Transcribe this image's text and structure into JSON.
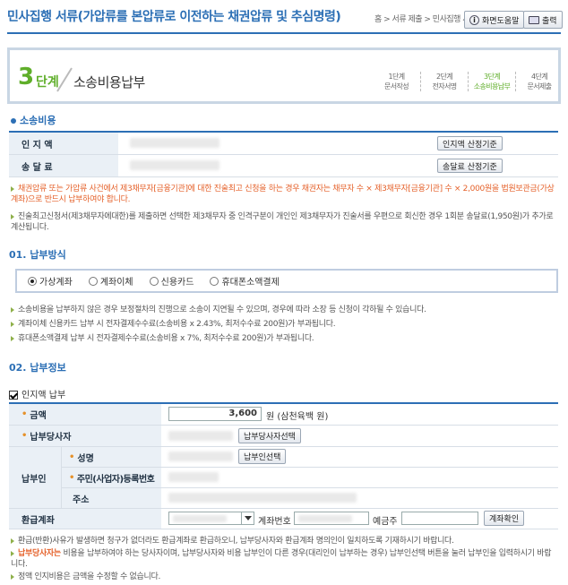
{
  "header": {
    "title": "민사집행 서류(가압류를 본압류로 이전하는 채권압류 및 추심명령)",
    "breadcrumb": "홈 > 서류 제출 > 민사집행 서",
    "help_label": "화면도움말",
    "print_label": "출력"
  },
  "step": {
    "number": "3",
    "unit": "단계",
    "name": "소송비용납부",
    "items": [
      {
        "line1": "1단계",
        "line2": "문서작성"
      },
      {
        "line1": "2단계",
        "line2": "전자서명"
      },
      {
        "line1": "3단계",
        "line2": "소송비용납부"
      },
      {
        "line1": "4단계",
        "line2": "문서제출"
      }
    ]
  },
  "cost": {
    "section_title": "소송비용",
    "stamp_label": "인 지 액",
    "stamp_btn": "인지액 산정기준",
    "postage_label": "송 달 료",
    "postage_btn": "송달료 산정기준",
    "note1": "채권압류 또는 가압류 사건에서 제3채무자[금융기관]에 대한 진술최고 신청을 하는 경우 채권자는 채무자 수 × 제3채무자[금융기관] 수 × 2,000원을 법원보관금(가상계좌)으로 반드시 납부하여야 합니다.",
    "note2": "진술최고신청서(제3채무자에대한)를 제출하면 선택한 제3채무자 중 인격구분이 개인인 제3채무자가 진술서를 우편으로 회신한 경우 1회분 송달료(1,950원)가 추가로 계산됩니다."
  },
  "method": {
    "section_title": "01. 납부방식",
    "options": [
      "가상계좌",
      "계좌이체",
      "신용카드",
      "휴대폰소액결제"
    ],
    "selected": "가상계좌",
    "notes": [
      "소송비용을 납부하지 않은 경우 보정절차의 진행으로 소송이 지연될 수 있으며, 경우에 따라 소장 등 신청이 각하될 수 있습니다.",
      "계좌이체 신용카드 납부 시 전자결제수수료(소송비용 x 2.43%, 최저수수료 200원)가 부과됩니다.",
      "휴대폰소액결제 납부 시 전자결제수수료(소송비용 x 7%, 최저수수료 200원)가 부과됩니다."
    ]
  },
  "info": {
    "section_title": "02. 납부정보",
    "checkbox_label": "인지액 납부",
    "amount_label": "금액",
    "amount_value": "3,600",
    "amount_suffix": "원 (삼천육백 원)",
    "payer_party_label": "납부당사자",
    "payer_party_btn": "납부당사자선택",
    "payer_label": "납부인",
    "name_label": "성명",
    "payer_btn": "납부인선택",
    "id_label": "주민(사업자)등록번호",
    "addr_label": "주소",
    "refund_label": "환급계좌",
    "account_no_label": "계좌번호",
    "holder_label": "예금주",
    "account_check_btn": "계좌확인",
    "note1": "환급(반환)사유가 발생하면 청구가 없더라도 환급계좌로 환급하오니, 납부당사자와 환급계좌 명의인이 일치하도록 기재하시기 바랍니다.",
    "note2_hl": "납부당사자는",
    "note2": " 비용을 납부하여야 하는 당사자이며, 납부당사자와 비용 납부인이 다른 경우(대리인이 납부하는 경우) 납부인선택 버튼을 눌러 납부인을 입력하시기 바랍니다.",
    "note3": "정액 인지비용은 금액을 수정할 수 없습니다."
  }
}
